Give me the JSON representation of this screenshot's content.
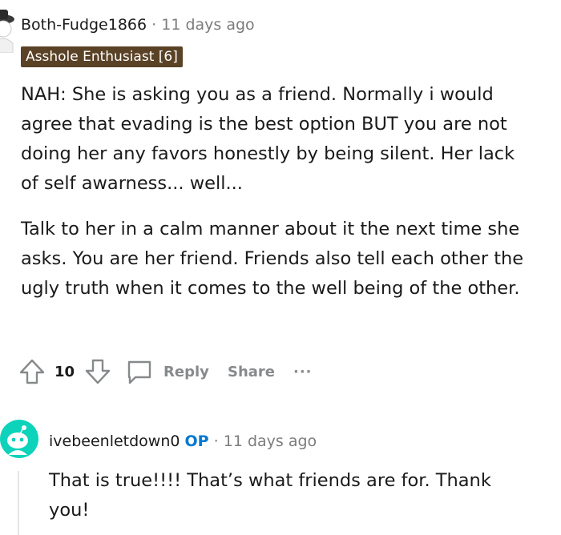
{
  "comment1": {
    "username": "Both-Fudge1866",
    "separator": "·",
    "timestamp": "11 days ago",
    "flair": "Asshole Enthusiast [6]",
    "paragraphs": [
      "NAH: She is asking you as a friend. Normally i would agree that evading is the best option BUT you are not doing her any favors honestly by being silent. Her lack of self awarness... well...",
      "Talk to her in a calm manner about it the next time she asks. You are her friend. Friends also tell each other the ugly truth when it comes to the well being of the other."
    ],
    "actions": {
      "vote_count": "10",
      "reply_label": "Reply",
      "share_label": "Share",
      "more_label": "···"
    }
  },
  "comment2": {
    "username": "ivebeenletdown0",
    "op_badge": "OP",
    "separator": "·",
    "timestamp": "11 days ago",
    "body": "That is true!!!! That’s what friends are for. Thank you!"
  },
  "colors": {
    "flair_bg": "#5a4226",
    "op_blue": "#0079d3",
    "avatar2_bg": "#0dd3bb",
    "meta_gray": "#7c7c7c",
    "action_gray": "#878a8c"
  },
  "icons": {
    "upvote": "arrow-up-outline",
    "downvote": "arrow-down-outline",
    "reply": "speech-bubble",
    "avatar2": "reddit-snoo"
  }
}
